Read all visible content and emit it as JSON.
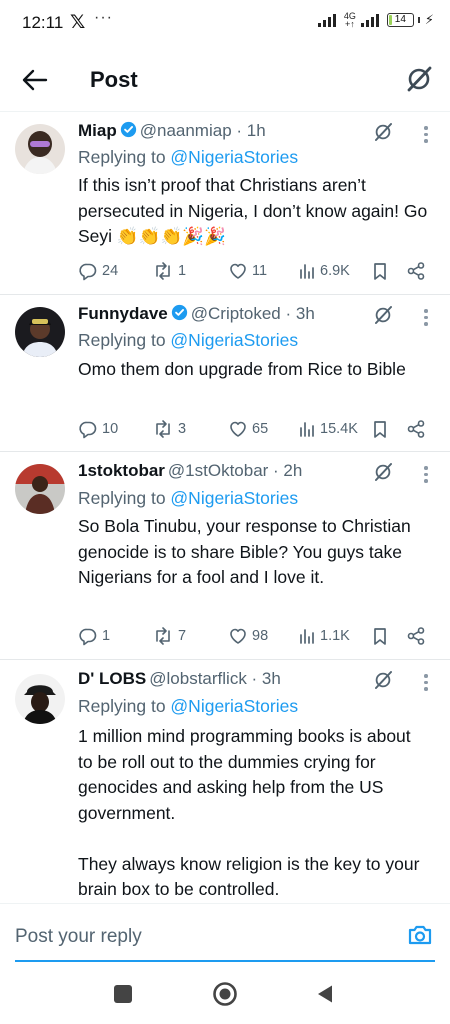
{
  "status_bar": {
    "time": "12:11",
    "x_logo": "𝕏",
    "dots": "···",
    "network_top": "4G",
    "network_bottom": "+↑",
    "battery": "14",
    "battery_level": 0.14
  },
  "header": {
    "title": "Post",
    "back_icon": "arrow-left-icon",
    "grok_icon": "grok-icon"
  },
  "tweets": [
    {
      "name": "Miap",
      "verified": true,
      "handle": "@naanmiap · 1h",
      "replying_prefix": "Replying to ",
      "replying_to": "@NigeriaStories",
      "text": "If this isn’t proof that Christians aren’t persecuted in Nigeria, I don’t know again! Go Seyi 👏👏👏🎉🎉",
      "replies": "24",
      "reposts": "1",
      "likes": "11",
      "views": "6.9K"
    },
    {
      "name": "Funnydave",
      "verified": true,
      "handle": "@Criptoked · 3h",
      "replying_prefix": "Replying to ",
      "replying_to": "@NigeriaStories",
      "text": "Omo them don upgrade from Rice to Bible",
      "replies": "10",
      "reposts": "3",
      "likes": "65",
      "views": "15.4K"
    },
    {
      "name": "1stoktobar",
      "verified": false,
      "handle": "@1stOktobar · 2h",
      "replying_prefix": "Replying to ",
      "replying_to": "@NigeriaStories",
      "text": "So Bola Tinubu, your response to Christian genocide is to share Bible? You guys take Nigerians for a fool and I love it.",
      "replies": "1",
      "reposts": "7",
      "likes": "98",
      "views": "1.1K"
    },
    {
      "name": "D' LOBS",
      "verified": false,
      "handle": "@lobstarflick · 3h",
      "replying_prefix": "Replying to ",
      "replying_to": "@NigeriaStories",
      "text": "1 million mind programming books is about to be roll out to the dummies crying for genocides and asking help from the US government.\n\nThey always know religion is the key to your brain box to be controlled."
    }
  ],
  "reply_bar": {
    "placeholder": "Post your reply",
    "camera_icon": "camera-icon"
  },
  "colors": {
    "accent": "#1d9bf0",
    "secondary_text": "#536471",
    "primary_text": "#0f1419"
  }
}
